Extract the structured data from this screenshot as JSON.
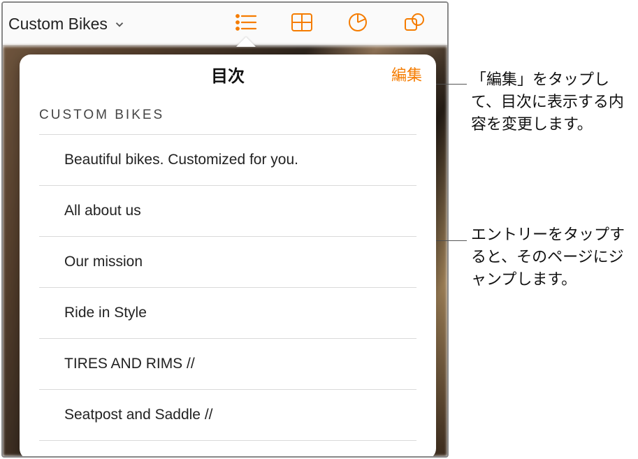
{
  "toolbar": {
    "doc_title": "Custom Bikes",
    "icons": {
      "chevron": "chevron-down-icon",
      "list": "list-view-icon",
      "grid": "grid-view-icon",
      "chart": "chart-view-icon",
      "shape": "shape-view-icon"
    }
  },
  "popover": {
    "title": "目次",
    "edit": "編集"
  },
  "toc": {
    "heading": "CUSTOM  BIKES",
    "items": [
      "Beautiful bikes. Customized for you.",
      "All about us",
      "Our mission",
      "Ride in Style",
      "TIRES AND RIMS //",
      "Seatpost and Saddle //"
    ]
  },
  "callouts": {
    "edit_hint": "「編集」をタップして、目次に表示する内容を変更します。",
    "entry_hint": "エントリーをタップすると、そのページにジャンプします。"
  }
}
